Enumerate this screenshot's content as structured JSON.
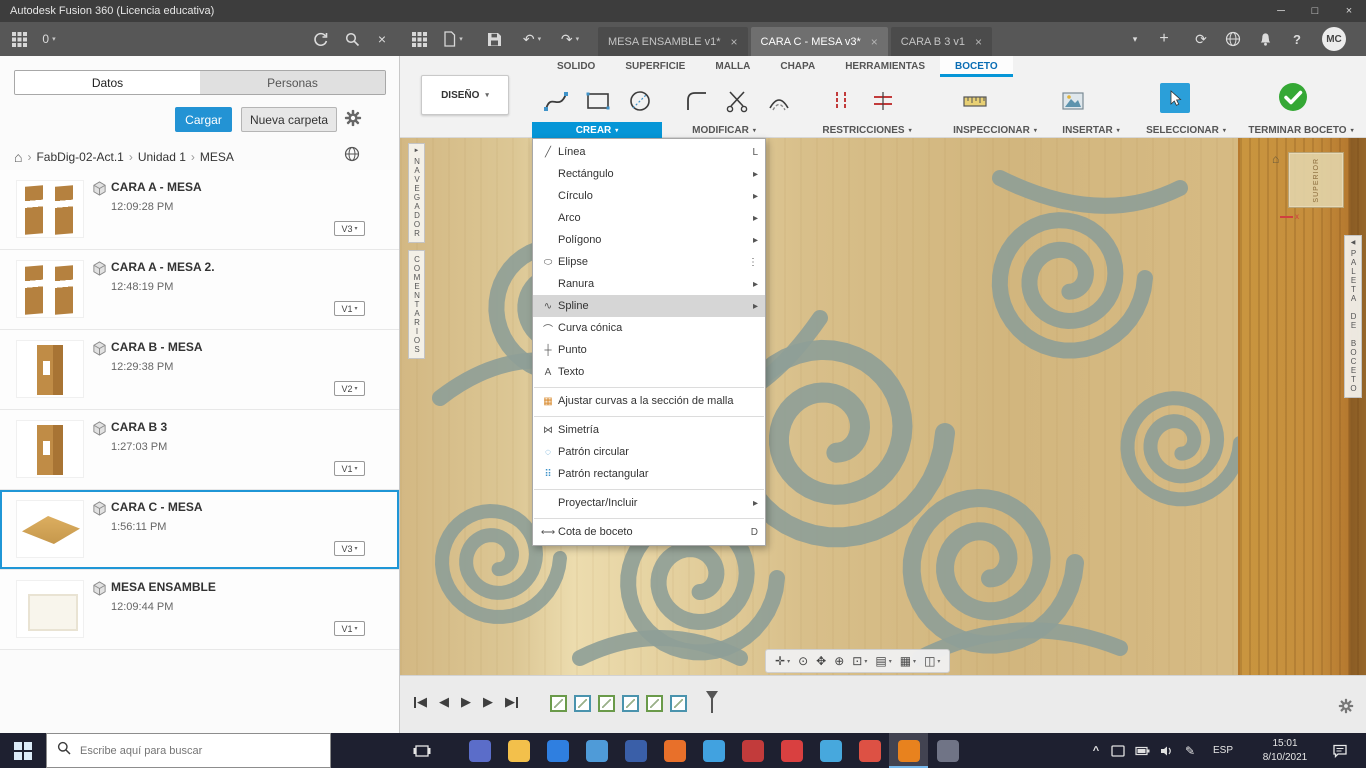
{
  "colors": {
    "accent_blue": "#0696d7",
    "finish_green": "#35a835",
    "selection_border": "#1f96d6",
    "wood_light": "#d8bf8a",
    "wood_dark": "#c08438",
    "pattern_teal": "#8e9e97",
    "taskbar_dark": "#1e2030"
  },
  "icons": {
    "caret_down": "▾",
    "chevron_right": "›",
    "close": "×",
    "minimize": "─",
    "maximize": "□",
    "home": "⌂",
    "undo": "↶",
    "redo": "↷",
    "plus": "+",
    "sync": "⟳",
    "prev": "◀",
    "next": "▶",
    "expand_right": "►",
    "collapse_left": "◀",
    "tray_caret": "^",
    "pen": "✎",
    "help": "?"
  },
  "window": {
    "title": "Autodesk Fusion 360 (Licencia educativa)"
  },
  "app_bar": {
    "job_count": "0",
    "avatar": "MC"
  },
  "doc_tabs": [
    {
      "label": "MESA ENSAMBLE v1*",
      "active": false
    },
    {
      "label": "CARA C - MESA v3*",
      "active": true
    },
    {
      "label": "CARA B 3 v1",
      "active": false
    }
  ],
  "data_panel": {
    "tabs": [
      {
        "label": "Datos",
        "active": true
      },
      {
        "label": "Personas",
        "active": false
      }
    ],
    "upload_button": "Cargar",
    "new_folder_button": "Nueva carpeta",
    "breadcrumb": [
      "FabDig-02-Act.1",
      "Unidad 1",
      "MESA"
    ],
    "items": [
      {
        "title": "CARA A - MESA",
        "time": "12:09:28 PM",
        "version": "V3",
        "thumb": "thumb-two-boards",
        "selected": false
      },
      {
        "title": "CARA A - MESA 2.",
        "time": "12:48:19 PM",
        "version": "V1",
        "thumb": "thumb-two-boards",
        "selected": false
      },
      {
        "title": "CARA B - MESA",
        "time": "12:29:38 PM",
        "version": "V2",
        "thumb": "thumb-board",
        "selected": false
      },
      {
        "title": "CARA B 3",
        "time": "1:27:03 PM",
        "version": "V1",
        "thumb": "thumb-board",
        "selected": false
      },
      {
        "title": "CARA C - MESA",
        "time": "1:56:11 PM",
        "version": "V3",
        "thumb": "thumb-flat",
        "selected": true
      },
      {
        "title": "MESA ENSAMBLE",
        "time": "12:09:44 PM",
        "version": "V1",
        "thumb": "thumb-assembly",
        "selected": false
      }
    ]
  },
  "ribbon": {
    "workspace_selector": "DISEÑO",
    "tabs": [
      {
        "label": "SOLIDO",
        "active": false
      },
      {
        "label": "SUPERFICIE",
        "active": false
      },
      {
        "label": "MALLA",
        "active": false
      },
      {
        "label": "CHAPA",
        "active": false
      },
      {
        "label": "HERRAMIENTAS",
        "active": false
      },
      {
        "label": "BOCETO",
        "active": true
      }
    ],
    "groups": [
      {
        "label": "CREAR",
        "open": true
      },
      {
        "label": "MODIFICAR"
      },
      {
        "label": "RESTRICCIONES"
      },
      {
        "label": "INSPECCIONAR"
      },
      {
        "label": "INSERTAR"
      },
      {
        "label": "SELECCIONAR"
      }
    ],
    "finish_button": "TERMINAR BOCETO"
  },
  "crear_menu": {
    "items": [
      {
        "label": "Línea",
        "icon": "╱",
        "right": "L"
      },
      {
        "label": "Rectángulo",
        "icon": "",
        "right": "▸"
      },
      {
        "label": "Círculo",
        "icon": "",
        "right": "▸"
      },
      {
        "label": "Arco",
        "icon": "",
        "right": "▸"
      },
      {
        "label": "Polígono",
        "icon": "",
        "right": "▸"
      },
      {
        "label": "Elipse",
        "icon": "⬭",
        "right": "⋮"
      },
      {
        "label": "Ranura",
        "icon": "",
        "right": "▸"
      },
      {
        "label": "Spline",
        "icon": "∿",
        "right": "▸",
        "highlight": true
      },
      {
        "label": "Curva cónica",
        "icon": "⌒",
        "right": ""
      },
      {
        "label": "Punto",
        "icon": "┼",
        "right": ""
      },
      {
        "label": "Texto",
        "icon": "A",
        "right": ""
      },
      {
        "separator": true
      },
      {
        "label": "Ajustar curvas a la sección de malla",
        "icon": "▦",
        "icon_color": "#d88a2e",
        "right": ""
      },
      {
        "separator": true
      },
      {
        "label": "Simetría",
        "icon": "⋈",
        "right": ""
      },
      {
        "label": "Patrón circular",
        "icon": "◌",
        "icon_color": "#3f93c9",
        "right": ""
      },
      {
        "label": "Patrón rectangular",
        "icon": "⠿",
        "icon_color": "#3f93c9",
        "right": ""
      },
      {
        "separator": true
      },
      {
        "label": "Proyectar/Incluir",
        "icon": "",
        "right": "▸"
      },
      {
        "separator": true
      },
      {
        "label": "Cota de boceto",
        "icon": "⟷",
        "right": "D"
      }
    ]
  },
  "canvas": {
    "view_cube_label": "SUPERIOR",
    "axis_x_label": "x",
    "left_tabs": [
      "NAVEGADOR",
      "COMENTARIOS"
    ],
    "right_tab": "PALETA DE BOCETO",
    "nav_icons": [
      {
        "name": "fit-view-icon",
        "char": "✛",
        "caret": true
      },
      {
        "name": "orbit-icon",
        "char": "⊙",
        "caret": false
      },
      {
        "name": "pan-icon",
        "char": "✥",
        "caret": false
      },
      {
        "name": "zoom-icon",
        "char": "⊕",
        "caret": false
      },
      {
        "name": "zoom-window-icon",
        "char": "⊡",
        "caret": true
      },
      {
        "name": "display-settings-icon",
        "char": "▤",
        "caret": true
      },
      {
        "name": "grid-settings-icon",
        "char": "▦",
        "caret": true
      },
      {
        "name": "viewports-icon",
        "char": "◫",
        "caret": true
      }
    ]
  },
  "timeline": {
    "items": [
      {
        "color": "#6a9a4a"
      },
      {
        "color": "#4a93ad"
      },
      {
        "color": "#6a9a4a"
      },
      {
        "color": "#4a93ad"
      },
      {
        "color": "#6a9a4a"
      },
      {
        "color": "#4a93ad"
      }
    ]
  },
  "taskbar": {
    "search_placeholder": "Escribe aquí para buscar",
    "language": "ESP",
    "time": "15:01",
    "date": "8/10/2021",
    "apps": [
      {
        "name": "microsoft-teams",
        "color": "#5b6dc9"
      },
      {
        "name": "file-explorer",
        "color": "#f3c04b"
      },
      {
        "name": "dropbox",
        "color": "#2f7fe0"
      },
      {
        "name": "outlook-mail",
        "color": "#4f9bd8"
      },
      {
        "name": "microsoft-word",
        "color": "#3a5fa8"
      },
      {
        "name": "firefox",
        "color": "#e8702a"
      },
      {
        "name": "internet-explorer",
        "color": "#41a2e0"
      },
      {
        "name": "adobe-acrobat",
        "color": "#c23b3b"
      },
      {
        "name": "opera",
        "color": "#d94040"
      },
      {
        "name": "skype",
        "color": "#47a8dd"
      },
      {
        "name": "google-chrome",
        "color": "#dd5144"
      },
      {
        "name": "fusion-360",
        "color": "#e8821e",
        "active": true
      },
      {
        "name": "tools-utility",
        "color": "#707486"
      }
    ]
  }
}
